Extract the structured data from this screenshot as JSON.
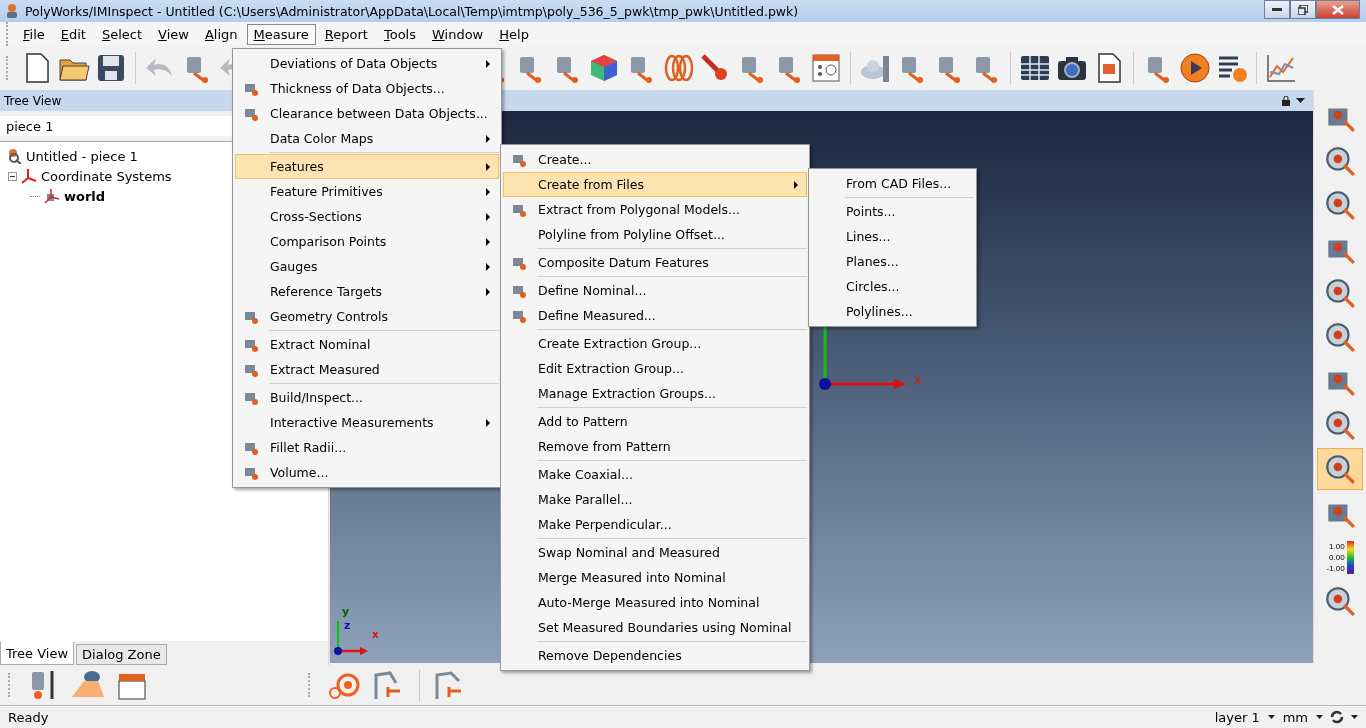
{
  "window": {
    "title": "PolyWorks/IMInspect - Untitled (C:\\Users\\Administrator\\AppData\\Local\\Temp\\imtmp\\poly_536_5_pwk\\tmp_pwk\\Untitled.pwk)"
  },
  "menubar": [
    {
      "label": "File",
      "selected": false
    },
    {
      "label": "Edit",
      "selected": false
    },
    {
      "label": "Select",
      "selected": false
    },
    {
      "label": "View",
      "selected": false
    },
    {
      "label": "Align",
      "selected": false
    },
    {
      "label": "Measure",
      "selected": true
    },
    {
      "label": "Report",
      "selected": false
    },
    {
      "label": "Tools",
      "selected": false
    },
    {
      "label": "Window",
      "selected": false
    },
    {
      "label": "Help",
      "selected": false
    }
  ],
  "tree_panel": {
    "title": "Tree View",
    "search": {
      "value": "piece 1"
    },
    "tree": [
      {
        "label": "Untitled - piece 1",
        "kind": "project",
        "active": false
      },
      {
        "label": "Coordinate Systems",
        "kind": "coords",
        "active": false,
        "expanded": true,
        "children": [
          {
            "label": "world",
            "kind": "system",
            "active": true
          }
        ]
      }
    ]
  },
  "bottom_tabs": [
    {
      "label": "Tree View",
      "selected": true
    },
    {
      "label": "Dialog Zone",
      "selected": false
    }
  ],
  "viewport": {
    "axis_label": "x",
    "triad_labels": [
      "y",
      "z",
      "x"
    ]
  },
  "right_toolbar": [
    {
      "selected": false
    },
    {
      "selected": false
    },
    {
      "selected": false
    },
    {
      "selected": false
    },
    {
      "selected": false
    },
    {
      "selected": false
    },
    {
      "selected": false
    },
    {
      "selected": false
    },
    {
      "selected": true
    },
    {
      "selected": false
    },
    {
      "selected": false
    },
    {
      "selected": false
    }
  ],
  "legend_icon": {
    "labels": [
      "1.00",
      "0.00",
      "-1.00"
    ]
  },
  "measure_menu": [
    {
      "kind": "item",
      "label": "Deviations of Data Objects",
      "submenu": true,
      "icon": false,
      "selected": false
    },
    {
      "kind": "item",
      "label": "Thickness of Data Objects...",
      "submenu": false,
      "icon": true,
      "selected": false
    },
    {
      "kind": "item",
      "label": "Clearance between Data Objects...",
      "submenu": false,
      "icon": true,
      "selected": false
    },
    {
      "kind": "item",
      "label": "Data Color Maps",
      "submenu": true,
      "icon": false,
      "selected": false
    },
    {
      "kind": "separator"
    },
    {
      "kind": "item",
      "label": "Features",
      "submenu": true,
      "icon": false,
      "selected": true
    },
    {
      "kind": "item",
      "label": "Feature Primitives",
      "submenu": true,
      "icon": false,
      "selected": false
    },
    {
      "kind": "item",
      "label": "Cross-Sections",
      "submenu": true,
      "icon": false,
      "selected": false
    },
    {
      "kind": "item",
      "label": "Comparison Points",
      "submenu": true,
      "icon": false,
      "selected": false
    },
    {
      "kind": "item",
      "label": "Gauges",
      "submenu": true,
      "icon": false,
      "selected": false
    },
    {
      "kind": "item",
      "label": "Reference Targets",
      "submenu": true,
      "icon": false,
      "selected": false
    },
    {
      "kind": "item",
      "label": "Geometry Controls",
      "submenu": false,
      "icon": true,
      "selected": false
    },
    {
      "kind": "separator"
    },
    {
      "kind": "item",
      "label": "Extract Nominal",
      "submenu": false,
      "icon": true,
      "selected": false
    },
    {
      "kind": "item",
      "label": "Extract Measured",
      "submenu": false,
      "icon": true,
      "selected": false
    },
    {
      "kind": "separator"
    },
    {
      "kind": "item",
      "label": "Build/Inspect...",
      "submenu": false,
      "icon": true,
      "selected": false
    },
    {
      "kind": "item",
      "label": "Interactive Measurements",
      "submenu": true,
      "icon": false,
      "selected": false
    },
    {
      "kind": "item",
      "label": "Fillet Radii...",
      "submenu": false,
      "icon": true,
      "selected": false
    },
    {
      "kind": "item",
      "label": "Volume...",
      "submenu": false,
      "icon": true,
      "selected": false
    }
  ],
  "features_menu": [
    {
      "kind": "item",
      "label": "Create...",
      "submenu": false,
      "icon": true,
      "selected": false
    },
    {
      "kind": "item",
      "label": "Create from Files",
      "submenu": true,
      "icon": false,
      "selected": true
    },
    {
      "kind": "item",
      "label": "Extract from Polygonal Models...",
      "submenu": false,
      "icon": true,
      "selected": false
    },
    {
      "kind": "item",
      "label": "Polyline from Polyline Offset...",
      "submenu": false,
      "icon": false,
      "selected": false
    },
    {
      "kind": "separator"
    },
    {
      "kind": "item",
      "label": "Composite Datum Features",
      "submenu": false,
      "icon": true,
      "selected": false
    },
    {
      "kind": "separator"
    },
    {
      "kind": "item",
      "label": "Define Nominal...",
      "submenu": false,
      "icon": true,
      "selected": false
    },
    {
      "kind": "item",
      "label": "Define Measured...",
      "submenu": false,
      "icon": true,
      "selected": false
    },
    {
      "kind": "separator"
    },
    {
      "kind": "item",
      "label": "Create Extraction Group...",
      "submenu": false,
      "icon": false,
      "selected": false
    },
    {
      "kind": "item",
      "label": "Edit Extraction Group...",
      "submenu": false,
      "icon": false,
      "selected": false
    },
    {
      "kind": "item",
      "label": "Manage Extraction Groups...",
      "submenu": false,
      "icon": false,
      "selected": false
    },
    {
      "kind": "separator"
    },
    {
      "kind": "item",
      "label": "Add to Pattern",
      "submenu": false,
      "icon": false,
      "selected": false
    },
    {
      "kind": "item",
      "label": "Remove from Pattern",
      "submenu": false,
      "icon": false,
      "selected": false
    },
    {
      "kind": "separator"
    },
    {
      "kind": "item",
      "label": "Make Coaxial...",
      "submenu": false,
      "icon": false,
      "selected": false
    },
    {
      "kind": "item",
      "label": "Make Parallel...",
      "submenu": false,
      "icon": false,
      "selected": false
    },
    {
      "kind": "item",
      "label": "Make Perpendicular...",
      "submenu": false,
      "icon": false,
      "selected": false
    },
    {
      "kind": "separator"
    },
    {
      "kind": "item",
      "label": "Swap Nominal and Measured",
      "submenu": false,
      "icon": false,
      "selected": false
    },
    {
      "kind": "item",
      "label": "Merge Measured into Nominal",
      "submenu": false,
      "icon": false,
      "selected": false
    },
    {
      "kind": "item",
      "label": "Auto-Merge Measured into Nominal",
      "submenu": false,
      "icon": false,
      "selected": false
    },
    {
      "kind": "item",
      "label": "Set Measured Boundaries using Nominal",
      "submenu": false,
      "icon": false,
      "selected": false
    },
    {
      "kind": "separator"
    },
    {
      "kind": "item",
      "label": "Remove Dependencies",
      "submenu": false,
      "icon": false,
      "selected": false
    }
  ],
  "files_menu": [
    {
      "kind": "item",
      "label": "From CAD Files...",
      "submenu": false,
      "icon": false,
      "selected": false
    },
    {
      "kind": "separator"
    },
    {
      "kind": "item",
      "label": "Points...",
      "submenu": false,
      "icon": false,
      "selected": false
    },
    {
      "kind": "item",
      "label": "Lines...",
      "submenu": false,
      "icon": false,
      "selected": false
    },
    {
      "kind": "item",
      "label": "Planes...",
      "submenu": false,
      "icon": false,
      "selected": false
    },
    {
      "kind": "item",
      "label": "Circles...",
      "submenu": false,
      "icon": false,
      "selected": false
    },
    {
      "kind": "item",
      "label": "Polylines...",
      "submenu": false,
      "icon": false,
      "selected": false
    }
  ],
  "status_bar": {
    "message": "Ready",
    "layer": "layer 1",
    "units": "mm"
  }
}
